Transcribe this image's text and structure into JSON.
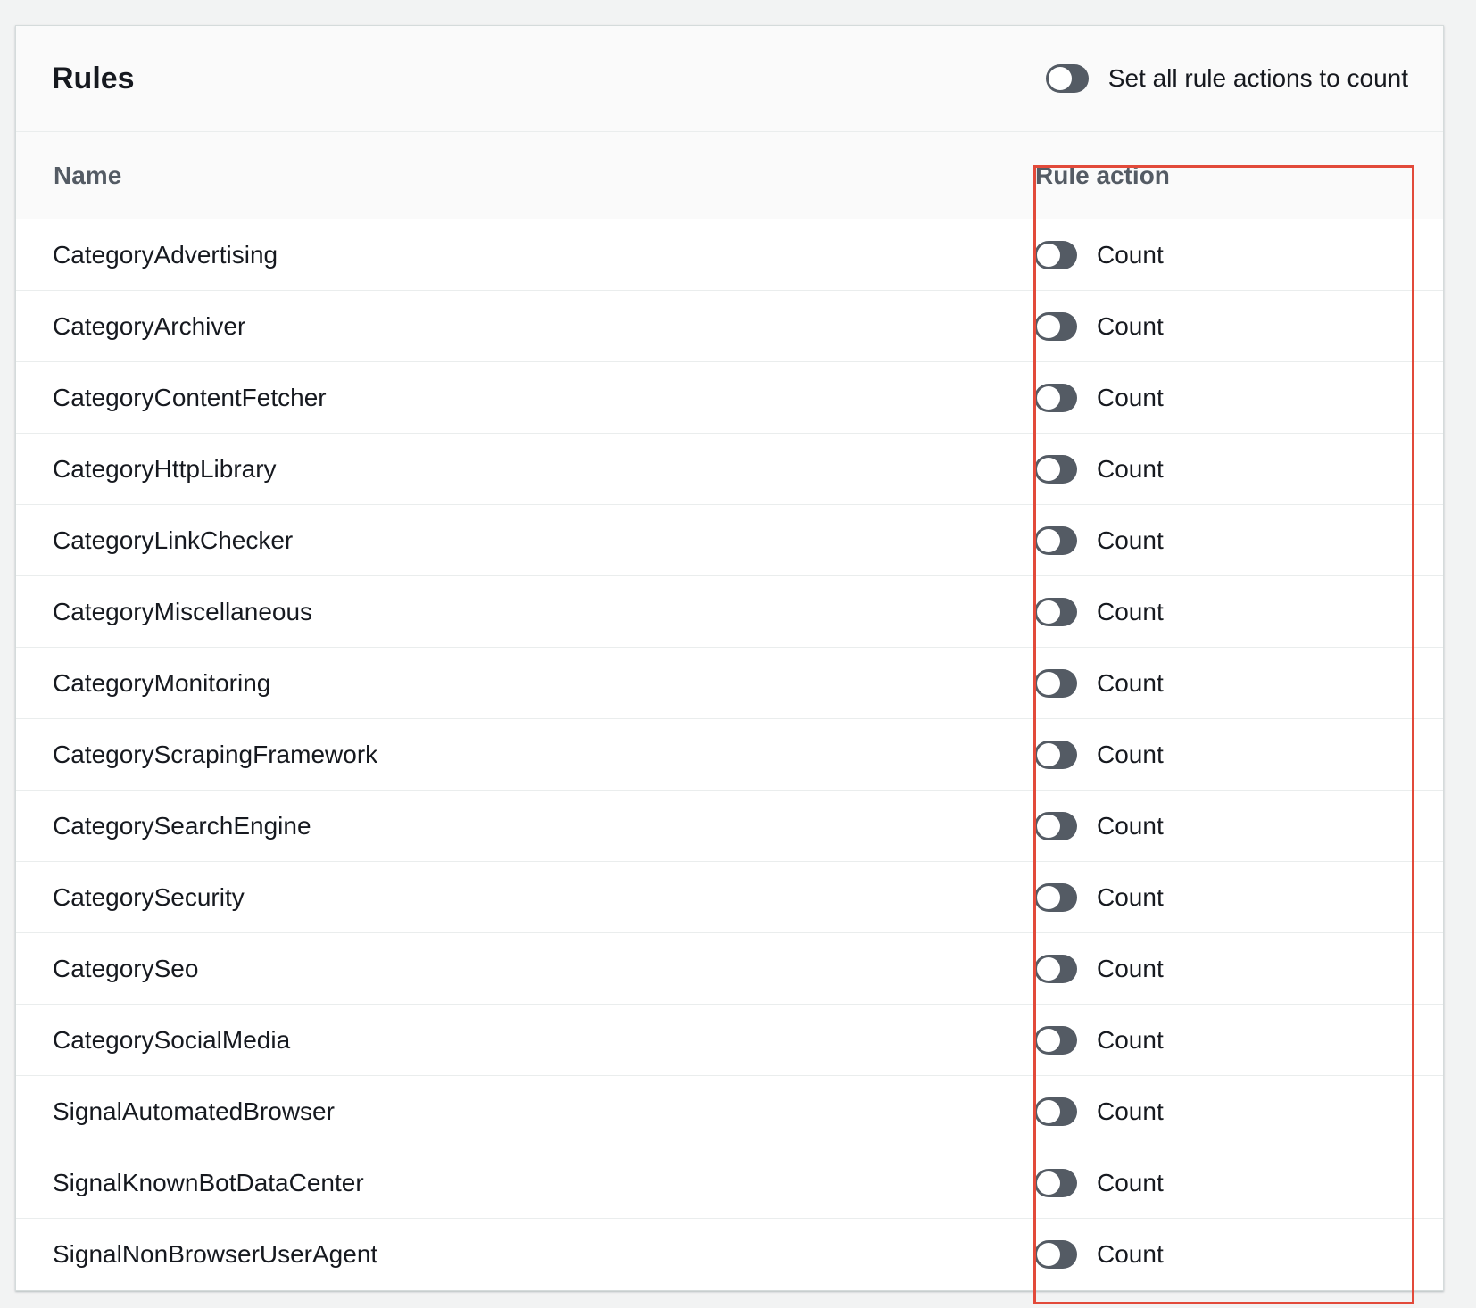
{
  "panel": {
    "title": "Rules",
    "toggle_all_label": "Set all rule actions to count"
  },
  "table": {
    "columns": [
      "Name",
      "Rule action"
    ],
    "rows": [
      {
        "name": "CategoryAdvertising",
        "action": "Count"
      },
      {
        "name": "CategoryArchiver",
        "action": "Count"
      },
      {
        "name": "CategoryContentFetcher",
        "action": "Count"
      },
      {
        "name": "CategoryHttpLibrary",
        "action": "Count"
      },
      {
        "name": "CategoryLinkChecker",
        "action": "Count"
      },
      {
        "name": "CategoryMiscellaneous",
        "action": "Count"
      },
      {
        "name": "CategoryMonitoring",
        "action": "Count"
      },
      {
        "name": "CategoryScrapingFramework",
        "action": "Count"
      },
      {
        "name": "CategorySearchEngine",
        "action": "Count"
      },
      {
        "name": "CategorySecurity",
        "action": "Count"
      },
      {
        "name": "CategorySeo",
        "action": "Count"
      },
      {
        "name": "CategorySocialMedia",
        "action": "Count"
      },
      {
        "name": "SignalAutomatedBrowser",
        "action": "Count"
      },
      {
        "name": "SignalKnownBotDataCenter",
        "action": "Count"
      },
      {
        "name": "SignalNonBrowserUserAgent",
        "action": "Count"
      }
    ]
  },
  "colors": {
    "toggle_off": "#545b64",
    "highlight": "#e24a3a",
    "header_bg": "#fafafa"
  }
}
